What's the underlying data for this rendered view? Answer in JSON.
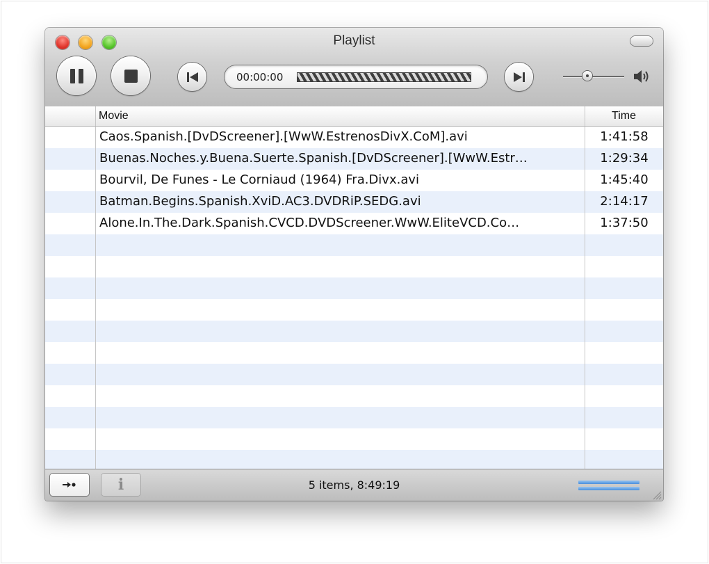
{
  "window": {
    "title": "Playlist"
  },
  "toolbar": {
    "icons": {
      "pause": "pause-icon",
      "stop": "stop-icon",
      "previous": "skip-back-icon",
      "next": "skip-forward-icon",
      "volume": "speaker-icon"
    },
    "elapsed_time": "00:00:00",
    "volume_level_fraction": 0.4
  },
  "table": {
    "columns": {
      "movie": "Movie",
      "time": "Time"
    },
    "rows": [
      {
        "movie": "Caos.Spanish.[DvDScreener].[WwW.EstrenosDivX.CoM].avi",
        "time": "1:41:58"
      },
      {
        "movie": "Buenas.Noches.y.Buena.Suerte.Spanish.[DvDScreener].[WwW.Estr…",
        "time": "1:29:34"
      },
      {
        "movie": "Bourvil, De Funes - Le Corniaud (1964) Fra.Divx.avi",
        "time": "1:45:40"
      },
      {
        "movie": "Batman.Begins.Spanish.XviD.AC3.DVDRiP.SEDG.avi",
        "time": "2:14:17"
      },
      {
        "movie": "Alone.In.The.Dark.Spanish.CVCD.DVDScreener.WwW.EliteVCD.Co…",
        "time": "1:37:50"
      }
    ]
  },
  "footer": {
    "shuffle_icon": "shuffle-arrow-icon",
    "info_glyph": "i",
    "status": "5 items, 8:49:19"
  },
  "colors": {
    "stripe": "#e9f0fb",
    "accent_blue": "#4a8fdc",
    "close": "#e0342b",
    "minimize": "#f3a51f",
    "zoom": "#56c52a"
  }
}
